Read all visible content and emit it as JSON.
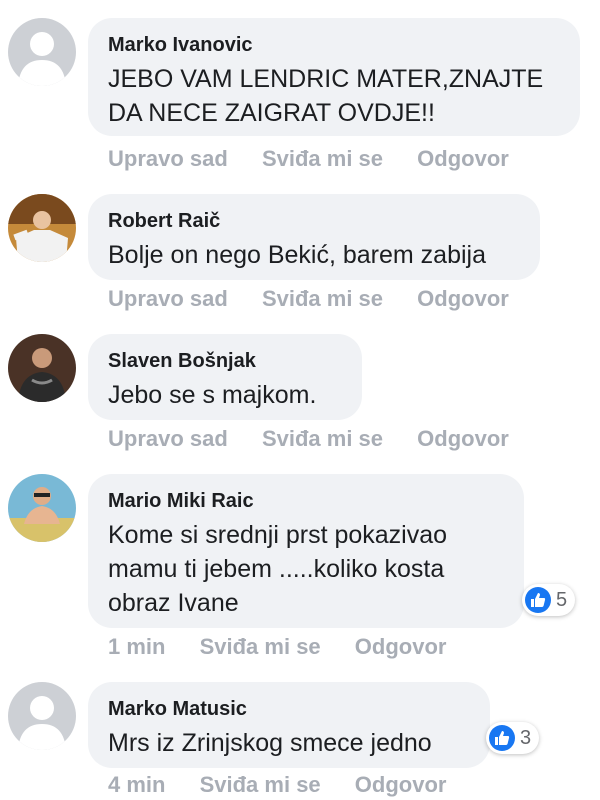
{
  "colors": {
    "bubble_bg": "#f0f2f5",
    "meta_text": "#a8adb5",
    "like_blue": "#1877f2"
  },
  "comments": [
    {
      "author": "Marko Ivanovic",
      "text": "JEBO VAM LENDRIC MATER,ZNAJTE\nDA NECE ZAIGRAT OVDJE!!",
      "time": "Upravo sad",
      "like_label": "Sviđa mi se",
      "reply_label": "Odgovor",
      "avatar": "default-avatar-icon"
    },
    {
      "author": "Robert Raič",
      "text": "Bolje on nego Bekić, barem zabija",
      "time": "Upravo sad",
      "like_label": "Sviđa mi se",
      "reply_label": "Odgovor",
      "avatar": "user-photo-avatar"
    },
    {
      "author": "Slaven Bošnjak",
      "text": "Jebo se s majkom.",
      "time": "Upravo sad",
      "like_label": "Sviđa mi se",
      "reply_label": "Odgovor",
      "avatar": "user-photo-avatar"
    },
    {
      "author": "Mario Miki Raic",
      "text": "Kome si srednji prst pokazivao\nmamu ti jebem .....koliko kosta\nobraz Ivane",
      "time": "1 min",
      "like_label": "Sviđa mi se",
      "reply_label": "Odgovor",
      "reactions": {
        "icon": "thumbs-up-icon",
        "count": "5"
      },
      "avatar": "user-photo-avatar"
    },
    {
      "author": "Marko Matusic",
      "text": "Mrs iz Zrinjskog smece jedno",
      "time": "4 min",
      "like_label": "Sviđa mi se",
      "reply_label": "Odgovor",
      "reactions": {
        "icon": "thumbs-up-icon",
        "count": "3"
      },
      "avatar": "default-avatar-icon"
    }
  ]
}
